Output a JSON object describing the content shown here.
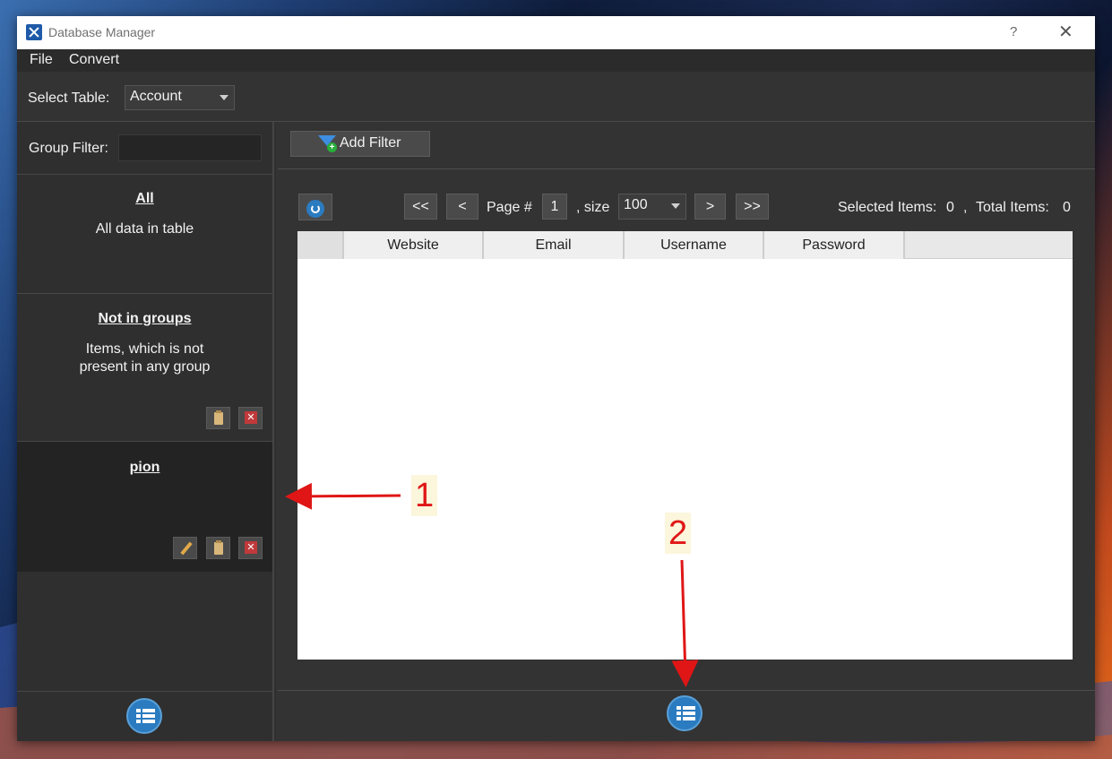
{
  "window": {
    "title": "Database Manager",
    "help_label": "?",
    "close_label": "✕"
  },
  "menu": {
    "file": "File",
    "convert": "Convert"
  },
  "table_select": {
    "label": "Select Table:",
    "value": "Account"
  },
  "group_filter": {
    "label": "Group Filter:",
    "value": ""
  },
  "groups": [
    {
      "title": "All",
      "description": "All data in table"
    },
    {
      "title": "Not in groups",
      "description_line1": "Items, which is not",
      "description_line2": "present in any group"
    },
    {
      "title": "pion",
      "description": ""
    }
  ],
  "add_filter": {
    "label": "Add Filter"
  },
  "pagination": {
    "first": "<<",
    "prev": "<",
    "page_label": "Page #",
    "page": "1",
    "size_label": ", size",
    "size": "100",
    "next": ">",
    "last": ">>"
  },
  "stats": {
    "selected_label": "Selected Items:",
    "selected": "0",
    "sep": ",",
    "total_label": "Total Items:",
    "total": "0"
  },
  "columns": [
    "Website",
    "Email",
    "Username",
    "Password"
  ],
  "annotations": {
    "a1": "1",
    "a2": "2"
  },
  "colors": {
    "accent": "#2b7bc0",
    "annotation": "#e01616",
    "panel": "#2f2f2f"
  }
}
